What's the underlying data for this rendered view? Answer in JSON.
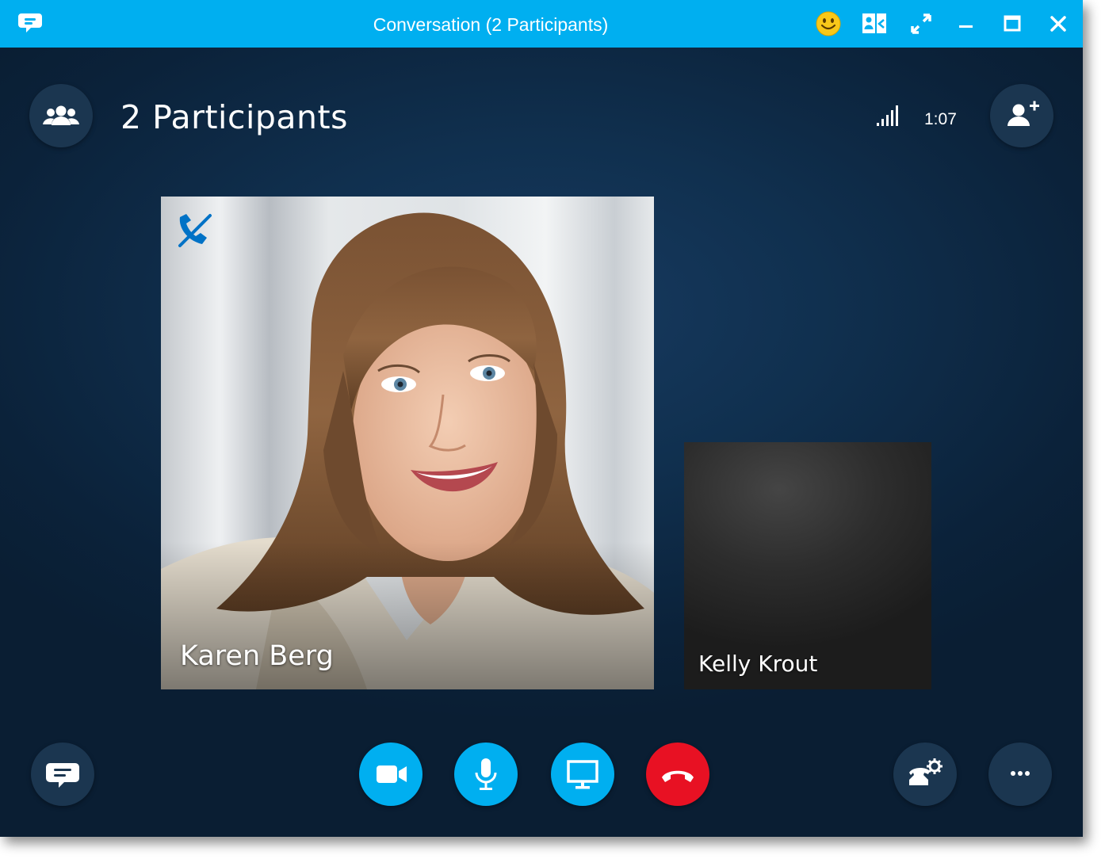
{
  "window": {
    "title": "Conversation (2 Participants)",
    "app_icon": "chat-bubble-icon",
    "controls": [
      "emoji-icon",
      "contact-card-icon",
      "full-screen-icon",
      "minimize-icon",
      "maximize-icon",
      "close-icon"
    ]
  },
  "header": {
    "participants_label": "2 Participants",
    "participants_icon": "people-icon",
    "signal_icon": "signal-strength-icon",
    "duration": "1:07",
    "add_people_icon": "add-person-icon"
  },
  "participants": [
    {
      "name": "Karen Berg",
      "status_icon": "phone-muted-icon"
    },
    {
      "name": "Kelly Krout"
    }
  ],
  "toolbar": {
    "left": [
      "conversation-icon"
    ],
    "center": [
      {
        "icon": "video-camera-icon",
        "color": "#00aff0"
      },
      {
        "icon": "microphone-icon",
        "color": "#00aff0"
      },
      {
        "icon": "present-screen-icon",
        "color": "#00aff0"
      },
      {
        "icon": "hang-up-icon",
        "color": "#e81123"
      }
    ],
    "right": [
      "call-controls-icon",
      "more-options-icon"
    ]
  },
  "colors": {
    "titlebar": "#00aff0",
    "background": "#0c2641",
    "button_dark": "#1b3650",
    "accent_blue": "#00aff0",
    "hangup_red": "#e81123"
  }
}
